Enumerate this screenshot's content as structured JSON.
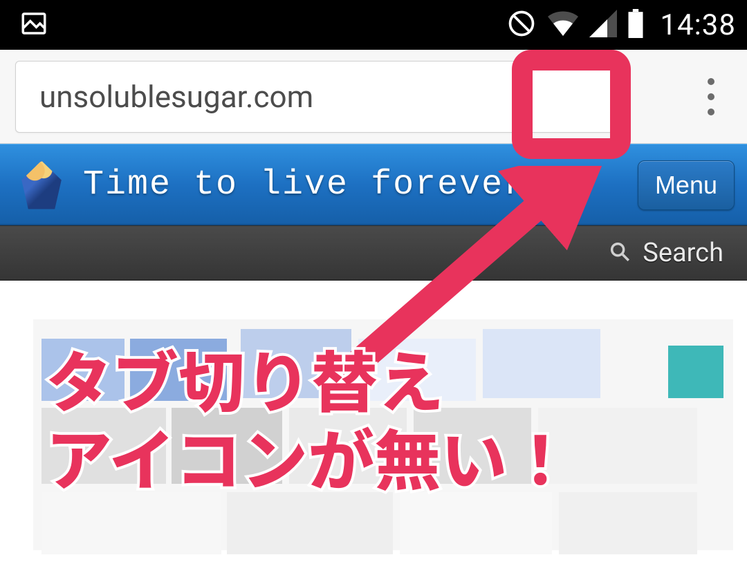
{
  "status_bar": {
    "clock": "14:38"
  },
  "browser": {
    "url_text": "unsolublesugar.com"
  },
  "site": {
    "title": "Time to live forever",
    "menu_button": "Menu"
  },
  "search_strip": {
    "label": "Search"
  },
  "annotation": {
    "line1": "タブ切り替え",
    "line2": "アイコンが無い！",
    "highlight_color": "#e8335c"
  }
}
